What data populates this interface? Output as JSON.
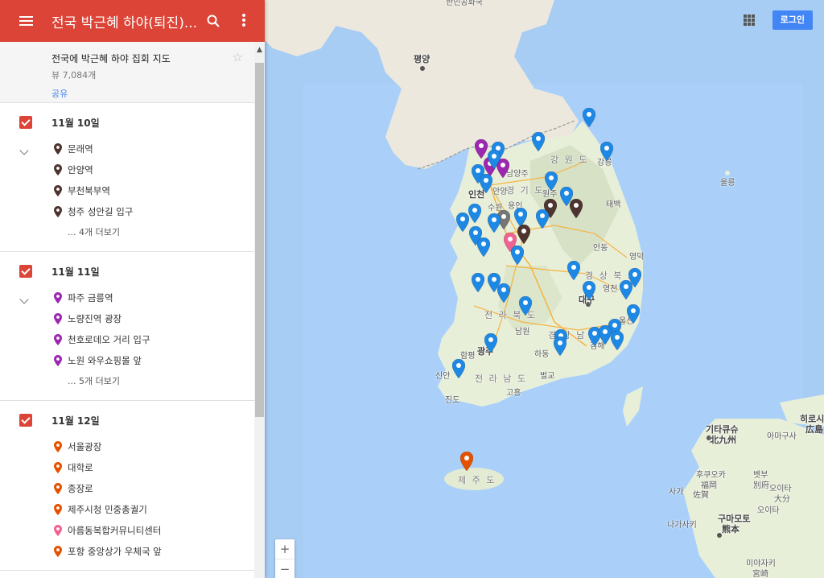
{
  "topbar": {
    "title": "전국 박근혜 하야(퇴진)..."
  },
  "map_info": {
    "description": "전국에 박근혜 하야 집회 지도",
    "views": "뷰 7,084개",
    "share": "공유"
  },
  "layers": [
    {
      "title": "11월 10일",
      "color": "#4e342e",
      "items": [
        {
          "label": "문래역",
          "color": "#4e342e"
        },
        {
          "label": "안양역",
          "color": "#4e342e"
        },
        {
          "label": "부천북부역",
          "color": "#4e342e"
        },
        {
          "label": "청주 성안길 입구",
          "color": "#4e342e"
        }
      ],
      "more": "... 4개 더보기"
    },
    {
      "title": "11월 11일",
      "color": "#9c27b0",
      "items": [
        {
          "label": "파주 금릉역",
          "color": "#9c27b0"
        },
        {
          "label": "노량진역 광장",
          "color": "#9c27b0"
        },
        {
          "label": "천호로데오 거리 입구",
          "color": "#9c27b0"
        },
        {
          "label": "노원 와우쇼핑몰 앞",
          "color": "#9c27b0"
        }
      ],
      "more": "... 5개 더보기"
    },
    {
      "title": "11월 12일",
      "color": "#e65100",
      "items": [
        {
          "label": "서울광장",
          "color": "#e65100"
        },
        {
          "label": "대학로",
          "color": "#e65100"
        },
        {
          "label": "종장로",
          "color": "#e65100"
        },
        {
          "label": "제주시청 민중총궐기",
          "color": "#e65100"
        },
        {
          "label": "아름동복합커뮤니티센터",
          "color": "#f06292"
        },
        {
          "label": "포항 중앙상가 우체국 앞",
          "color": "#e65100"
        }
      ],
      "more": ""
    }
  ],
  "header_right": {
    "login": "로그인"
  },
  "zoom": {
    "in": "+",
    "out": "−"
  },
  "map_labels": {
    "pyongyang": "평양",
    "top_cut": "한민공화국",
    "gangwon": "강 원 도",
    "gyeonggi": "경 기 도",
    "namyangju": "남양주",
    "incheon": "인천",
    "anyang": "안양",
    "suwon": "수원",
    "yongin": "용인",
    "wonju": "원주",
    "gangneung": "강릉",
    "ulleung": "울릉",
    "taebaek": "태백",
    "andong": "안동",
    "yeongdeok": "영덕",
    "gyeongbuk": "경 상 북 도",
    "yeongcheon": "영천",
    "daegu": "대구",
    "ulsan": "울산",
    "jeonbuk": "전 라 북 도",
    "gyeongnam": "경 상 남 도",
    "namwon": "남원",
    "hadong": "하동",
    "gimhae": "김해",
    "hampyeong": "함평",
    "gwangju": "광주",
    "jeonnam": "전 라 남 도",
    "sinan": "신안",
    "beolgyo": "벌교",
    "jindo": "진도",
    "goheung": "고흥",
    "jeju": "제 주 도",
    "kitakyushu": "기타큐슈",
    "kitakyushu_jp": "北九州",
    "amakusa_top": "아마구사",
    "hiroshima": "히로시",
    "hiroshima_jp": "広島",
    "fukuoka": "후쿠오카",
    "fukuoka_jp": "福岡",
    "saga": "사가",
    "saga_jp": "佐賀",
    "beppu": "벳부",
    "beppu_jp": "別府",
    "oita": "오이타",
    "oita_jp": "大分",
    "oita2": "오이타",
    "kumamoto": "구마모토",
    "kumamoto_jp": "熊本",
    "nagasaki": "나가사키",
    "miyazaki": "미야자키",
    "miyazaki_jp": "宮崎"
  }
}
